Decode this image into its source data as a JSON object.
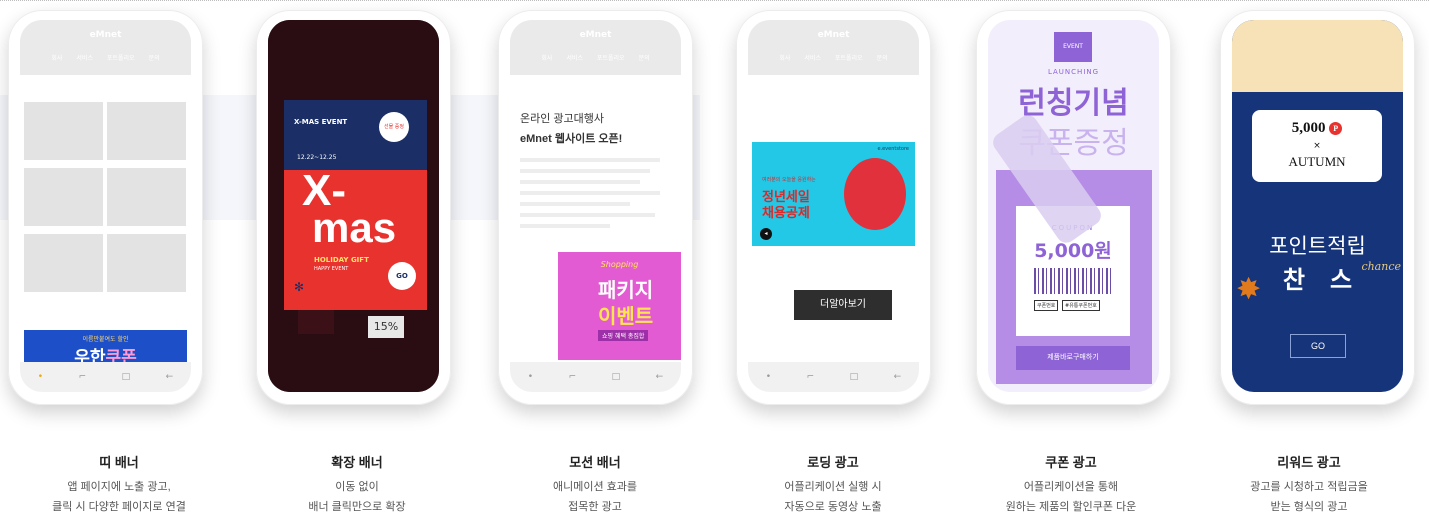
{
  "phone_header": {
    "title": "eMnet",
    "nav": [
      "회사",
      "서비스",
      "포트폴리오",
      "문의"
    ]
  },
  "navbar_icons": [
    "•",
    "⌐",
    "□",
    "←"
  ],
  "products": [
    {
      "title": "띠 배너",
      "desc1": "앱 페이지에 노출 광고,",
      "desc2": "클릭 시 다양한 페이지로 연결"
    },
    {
      "title": "확장 배너",
      "desc1": "이동 없이",
      "desc2": "배너 클릭만으로 확장"
    },
    {
      "title": "모션 배너",
      "desc1": "애니메이션 효과를",
      "desc2": "접목한 광고"
    },
    {
      "title": "로딩 광고",
      "desc1": "어플리케이션 실행 시",
      "desc2": "자동으로 동영상 노출"
    },
    {
      "title": "쿠폰 광고",
      "desc1": "어플리케이션을 통해",
      "desc2": "원하는 제품의 할인쿠폰 다운"
    },
    {
      "title": "리워드 광고",
      "desc1": "광고를 시청하고 적립금을",
      "desc2": "받는 형식의 광고"
    }
  ],
  "strip_banner": {
    "sub": "이름만붙여도 할인",
    "main": "우한",
    "accent": "쿠폰"
  },
  "xmas": {
    "event": "X-MAS EVENT",
    "date": "12.22~12.25",
    "word1": "X-",
    "word2": "mas",
    "gift": "HOLIDAY GIFT",
    "gift2": "HAPPY EVENT",
    "sale": "15%",
    "go": "GO",
    "badge": "선물 증정"
  },
  "motion": {
    "headline1": "온라인 광고대행사",
    "headline2": "eMnet 웹사이트 오픈!",
    "banner_top": "Shopping",
    "banner_main1": "패키지",
    "banner_main2": "이벤트",
    "banner_sub": "쇼핑 혜택 총집합"
  },
  "loading": {
    "brand": "e.eventstore",
    "line1": "여러분의 오늘을 응원하는",
    "line2": "정년세일",
    "line3": "채용공제",
    "more_button": "더알아보기"
  },
  "coupon": {
    "tag": "EVENT",
    "launching": "LAUNCHING",
    "headline1": "런칭기념",
    "headline2": "쿠폰증정",
    "coupon_label": "COUPON",
    "amount": "5,000원",
    "code_label": "쿠폰번호",
    "code_value": "#유통쿠폰번호",
    "buy_button": "제품바로구매하기"
  },
  "reward": {
    "amount": "5,000",
    "point_mark": "P",
    "times": "×",
    "autumn": "AUTUMN",
    "headline": "포인트적립",
    "chance": "찬   스",
    "chance_script": "chance",
    "go": "GO"
  },
  "colors": {
    "red": "#e8322e",
    "purple": "#8e63d6",
    "navy": "#15347a",
    "cyan": "#22c8e6",
    "pink": "#e35bd2"
  }
}
